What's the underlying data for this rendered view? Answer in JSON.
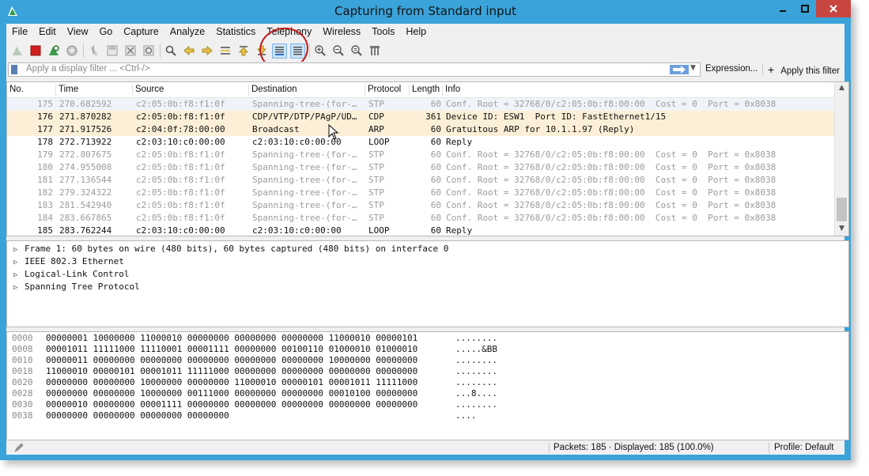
{
  "window": {
    "title": "Capturing from Standard input"
  },
  "menu": [
    "File",
    "Edit",
    "View",
    "Go",
    "Capture",
    "Analyze",
    "Statistics",
    "Telephony",
    "Wireless",
    "Tools",
    "Help"
  ],
  "toolbar": {
    "icons": [
      "shark-fin-start-icon",
      "stop-capture-icon",
      "restart-capture-icon",
      "capture-options-icon",
      "open-file-icon",
      "save-file-icon",
      "close-file-icon",
      "reload-file-icon",
      "find-packet-icon",
      "go-back-icon",
      "go-forward-icon",
      "go-to-packet-icon",
      "go-first-icon",
      "go-last-icon",
      "autoscroll-icon",
      "colorize-icon",
      "zoom-in-icon",
      "zoom-out-icon",
      "zoom-normal-icon",
      "resize-columns-icon"
    ],
    "pressed": [
      "autoscroll-icon",
      "colorize-icon"
    ]
  },
  "filter": {
    "placeholder": "Apply a display filter ... <Ctrl-/>",
    "expression_label": "Expression...",
    "apply_label": "Apply this filter",
    "apply_plus": "+"
  },
  "packet_list": {
    "columns": [
      "No.",
      "Time",
      "Source",
      "Destination",
      "Protocol",
      "Length",
      "Info"
    ],
    "rows": [
      {
        "no": "175",
        "time": "270.682592",
        "source": "c2:05:0b:f8:f1:0f",
        "destination": "Spanning-tree-(for-…",
        "protocol": "STP",
        "length": "60",
        "info": "Conf. Root = 32768/0/c2:05:0b:f8:00:00  Cost = 0  Port = 0x8038",
        "style": "stp"
      },
      {
        "no": "176",
        "time": "271.870282",
        "source": "c2:05:0b:f8:f1:0f",
        "destination": "CDP/VTP/DTP/PAgP/UD…",
        "protocol": "CDP",
        "length": "361",
        "info": "Device ID: ESW1  Port ID: FastEthernet1/15",
        "style": "cdp"
      },
      {
        "no": "177",
        "time": "271.917526",
        "source": "c2:04:0f:78:00:00",
        "destination": "Broadcast",
        "protocol": "ARP",
        "length": "60",
        "info": "Gratuitous ARP for 10.1.1.97 (Reply)",
        "style": "cdp"
      },
      {
        "no": "178",
        "time": "272.713922",
        "source": "c2:03:10:c0:00:00",
        "destination": "c2:03:10:c0:00:00",
        "protocol": "LOOP",
        "length": "60",
        "info": "Reply",
        "style": "loop"
      },
      {
        "no": "179",
        "time": "272.807675",
        "source": "c2:05:0b:f8:f1:0f",
        "destination": "Spanning-tree-(for-…",
        "protocol": "STP",
        "length": "60",
        "info": "Conf. Root = 32768/0/c2:05:0b:f8:00:00  Cost = 0  Port = 0x8038",
        "style": "stp"
      },
      {
        "no": "180",
        "time": "274.955008",
        "source": "c2:05:0b:f8:f1:0f",
        "destination": "Spanning-tree-(for-…",
        "protocol": "STP",
        "length": "60",
        "info": "Conf. Root = 32768/0/c2:05:0b:f8:00:00  Cost = 0  Port = 0x8038",
        "style": "stp"
      },
      {
        "no": "181",
        "time": "277.136544",
        "source": "c2:05:0b:f8:f1:0f",
        "destination": "Spanning-tree-(for-…",
        "protocol": "STP",
        "length": "60",
        "info": "Conf. Root = 32768/0/c2:05:0b:f8:00:00  Cost = 0  Port = 0x8038",
        "style": "stp"
      },
      {
        "no": "182",
        "time": "279.324322",
        "source": "c2:05:0b:f8:f1:0f",
        "destination": "Spanning-tree-(for-…",
        "protocol": "STP",
        "length": "60",
        "info": "Conf. Root = 32768/0/c2:05:0b:f8:00:00  Cost = 0  Port = 0x8038",
        "style": "stp"
      },
      {
        "no": "183",
        "time": "281.542940",
        "source": "c2:05:0b:f8:f1:0f",
        "destination": "Spanning-tree-(for-…",
        "protocol": "STP",
        "length": "60",
        "info": "Conf. Root = 32768/0/c2:05:0b:f8:00:00  Cost = 0  Port = 0x8038",
        "style": "stp"
      },
      {
        "no": "184",
        "time": "283.667865",
        "source": "c2:05:0b:f8:f1:0f",
        "destination": "Spanning-tree-(for-…",
        "protocol": "STP",
        "length": "60",
        "info": "Conf. Root = 32768/0/c2:05:0b:f8:00:00  Cost = 0  Port = 0x8038",
        "style": "stp"
      },
      {
        "no": "185",
        "time": "283.762244",
        "source": "c2:03:10:c0:00:00",
        "destination": "c2:03:10:c0:00:00",
        "protocol": "LOOP",
        "length": "60",
        "info": "Reply",
        "style": "loop"
      }
    ]
  },
  "details": [
    "Frame 1: 60 bytes on wire (480 bits), 60 bytes captured (480 bits) on interface 0",
    "IEEE 802.3 Ethernet",
    "Logical-Link Control",
    "Spanning Tree Protocol"
  ],
  "bytes": [
    {
      "offset": "0000",
      "hex": "00000001 10000000 11000010 00000000 00000000 00000000 11000010 00000101",
      "ascii": "........"
    },
    {
      "offset": "0008",
      "hex": "00001011 11111000 11110001 00001111 00000000 00100110 01000010 01000010",
      "ascii": ".....&BB"
    },
    {
      "offset": "0010",
      "hex": "00000011 00000000 00000000 00000000 00000000 00000000 10000000 00000000",
      "ascii": "........"
    },
    {
      "offset": "0018",
      "hex": "11000010 00000101 00001011 11111000 00000000 00000000 00000000 00000000",
      "ascii": "........"
    },
    {
      "offset": "0020",
      "hex": "00000000 00000000 10000000 00000000 11000010 00000101 00001011 11111000",
      "ascii": "........"
    },
    {
      "offset": "0028",
      "hex": "00000000 00000000 10000000 00111000 00000000 00000000 00010100 00000000",
      "ascii": "...8...."
    },
    {
      "offset": "0030",
      "hex": "00000010 00000000 00001111 00000000 00000000 00000000 00000000 00000000",
      "ascii": "........"
    },
    {
      "offset": "0038",
      "hex": "00000000 00000000 00000000 00000000",
      "ascii": "...."
    }
  ],
  "status": {
    "packets": "Packets: 185 · Displayed: 185 (100.0%)",
    "profile": "Profile: Default"
  },
  "colors": {
    "titlebar": "#3aa3d9",
    "cdp_row": "#fcefd7",
    "stp_text": "#9b9b9b",
    "annotation_circle": "#c21a1a",
    "close_button": "#c7463f"
  }
}
